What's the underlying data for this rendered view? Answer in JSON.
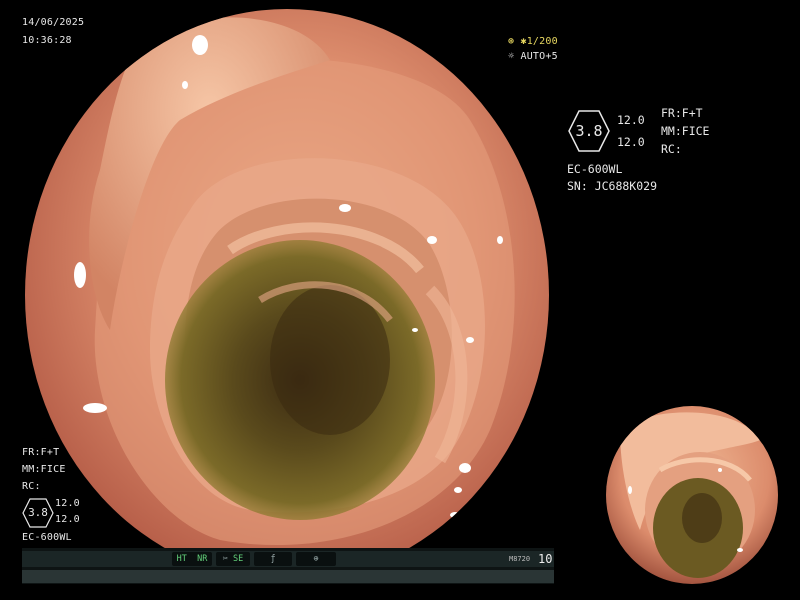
{
  "osd": {
    "date": "14/06/2025",
    "time": "10:36:28",
    "shutter": "1/200",
    "auto_mode": "AUTO+5",
    "right_panel": {
      "hex_value": "3.8",
      "value_top": "12.0",
      "value_bottom": "12.0",
      "fr": "FR:F+T",
      "mm": "MM:FICE",
      "rc": "RC:",
      "scope_model": "EC-600WL",
      "serial": "SN: JC688K029"
    },
    "left_panel": {
      "fr": "FR:F+T",
      "mm": "MM:FICE",
      "rc": "RC:",
      "hex_value": "3.8",
      "value_top": "12.0",
      "value_bottom": "12.0",
      "scope_model": "EC-600WL"
    },
    "status_bar": {
      "ht": "HT",
      "nr": "NR",
      "se": "SE",
      "model_code": "M8720",
      "counter": "10"
    }
  },
  "colors": {
    "text": "#e8e8e8",
    "accent_yellow": "#e8d860",
    "status_green": "#63d07a",
    "tissue_pink": "#d88a6c",
    "lumen_dark": "#3a2a10"
  }
}
